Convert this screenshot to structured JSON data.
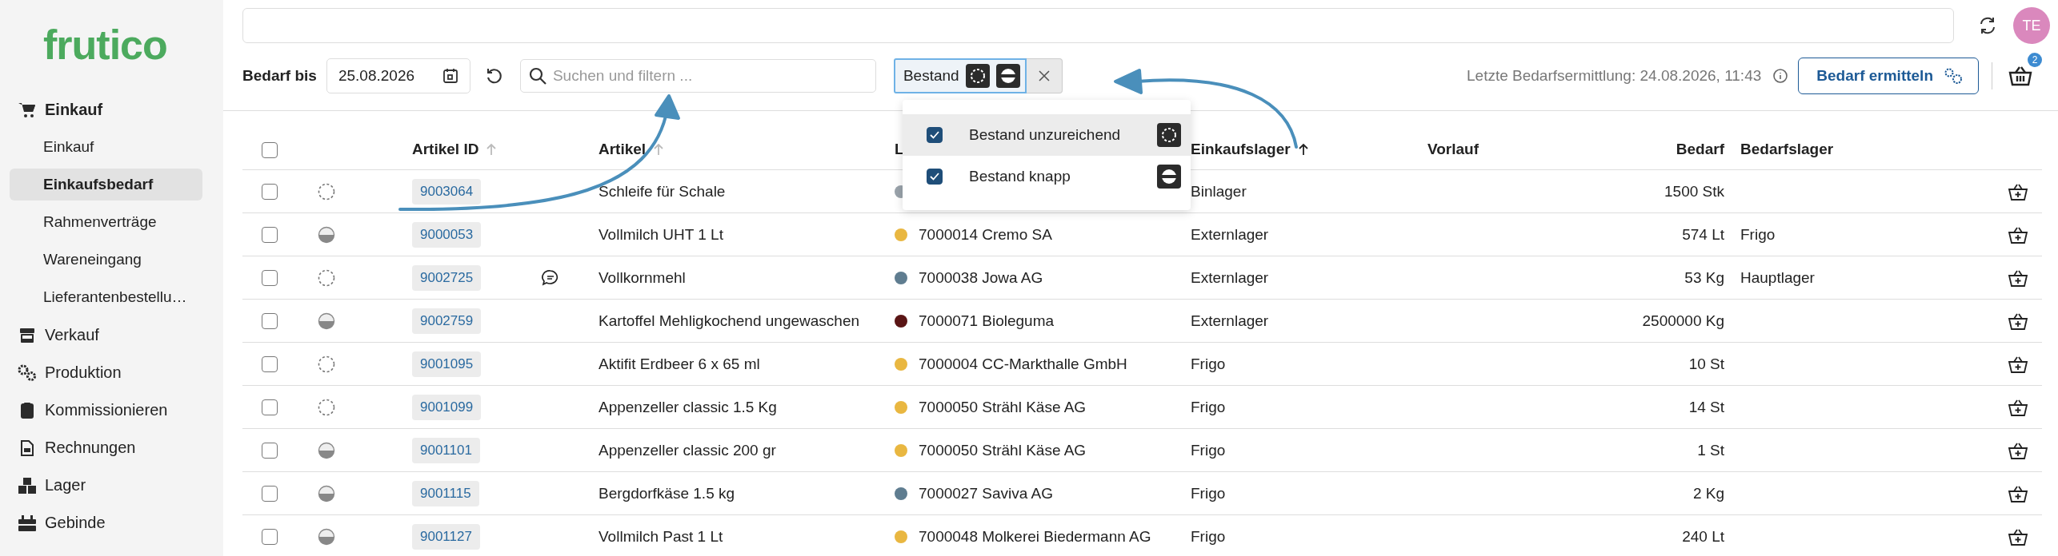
{
  "sidebar": {
    "logo": "frutico",
    "items": [
      {
        "label": "Einkauf",
        "expanded": true,
        "children": [
          {
            "label": "Einkauf",
            "selected": false
          },
          {
            "label": "Einkaufsbedarf",
            "selected": true
          },
          {
            "label": "Rahmenverträge",
            "selected": false
          },
          {
            "label": "Wareneingang",
            "selected": false
          },
          {
            "label": "Lieferantenbestellu…",
            "selected": false
          }
        ]
      },
      {
        "label": "Verkauf",
        "expanded": false
      },
      {
        "label": "Produktion",
        "expanded": false
      },
      {
        "label": "Kommissionieren",
        "expanded": false
      },
      {
        "label": "Rechnungen",
        "expanded": false
      },
      {
        "label": "Lager",
        "expanded": false
      },
      {
        "label": "Gebinde",
        "expanded": false
      }
    ]
  },
  "header": {
    "avatar": "TE"
  },
  "toolbar": {
    "date_label": "Bedarf bis",
    "date": "25.08.2026",
    "search": {
      "placeholder": "Suchen und filtern ..."
    },
    "filter_chip": {
      "label": "Bestand",
      "icons": [
        {
          "kind": "insufficient"
        },
        {
          "kind": "low"
        }
      ]
    },
    "last_run": "Letzte Bedarfsermittlung: 24.08.2026, 11:43",
    "action_button": "Bedarf ermitteln",
    "basket_badge": "2"
  },
  "filter_menu": {
    "items": [
      {
        "label": "Bestand unzureichend",
        "checked": true,
        "selected": true,
        "kind": "insufficient"
      },
      {
        "label": "Bestand knapp",
        "checked": true,
        "selected": false,
        "kind": "low"
      }
    ]
  },
  "table": {
    "select_all": {
      "checked": false
    },
    "columns": [
      {
        "label": "Artikel ID",
        "sorted": false
      },
      {
        "label": "Artikel",
        "sorted": false
      },
      {
        "label": "L"
      },
      {
        "label": "Einkaufslager",
        "sorted": true
      },
      {
        "label": "Vorlauf"
      },
      {
        "label": "Bedarf"
      },
      {
        "label": "Bedarfslager"
      }
    ],
    "rows": [
      {
        "checked": false,
        "kind": "insufficient",
        "id": "9003064",
        "comment": false,
        "article": "Schleife für Schale",
        "color": "#9aa3ab",
        "supplier": "",
        "warehouse": "Binlager",
        "demand": "1500 Stk",
        "demand_warehouse": ""
      },
      {
        "checked": false,
        "kind": "low",
        "id": "9000053",
        "comment": false,
        "article": "Vollmilch UHT 1 Lt",
        "color": "#e9b741",
        "supplier": "7000014 Cremo SA",
        "warehouse": "Externlager",
        "demand": "574 Lt",
        "demand_warehouse": "Frigo"
      },
      {
        "checked": false,
        "kind": "insufficient",
        "id": "9002725",
        "comment": true,
        "article": "Vollkornmehl",
        "color": "#5f7d90",
        "supplier": "7000038 Jowa AG",
        "warehouse": "Externlager",
        "demand": "53 Kg",
        "demand_warehouse": "Hauptlager"
      },
      {
        "checked": false,
        "kind": "low",
        "id": "9002759",
        "comment": false,
        "article": "Kartoffel Mehligkochend ungewaschen",
        "color": "#5a1515",
        "supplier": "7000071 Bioleguma",
        "warehouse": "Externlager",
        "demand": "2500000 Kg",
        "demand_warehouse": ""
      },
      {
        "checked": false,
        "kind": "insufficient",
        "id": "9001095",
        "comment": false,
        "article": "Aktifit Erdbeer 6 x 65 ml",
        "color": "#e9b741",
        "supplier": "7000004 CC-Markthalle GmbH",
        "warehouse": "Frigo",
        "demand": "10 St",
        "demand_warehouse": ""
      },
      {
        "checked": false,
        "kind": "insufficient",
        "id": "9001099",
        "comment": false,
        "article": "Appenzeller classic 1.5 Kg",
        "color": "#e9b741",
        "supplier": "7000050 Strähl Käse AG",
        "warehouse": "Frigo",
        "demand": "14 St",
        "demand_warehouse": ""
      },
      {
        "checked": false,
        "kind": "low",
        "id": "9001101",
        "comment": false,
        "article": "Appenzeller classic 200 gr",
        "color": "#e9b741",
        "supplier": "7000050 Strähl Käse AG",
        "warehouse": "Frigo",
        "demand": "1 St",
        "demand_warehouse": ""
      },
      {
        "checked": false,
        "kind": "low",
        "id": "9001115",
        "comment": false,
        "article": "Bergdorfkäse 1.5 kg",
        "color": "#5f7d90",
        "supplier": "7000027 Saviva AG",
        "warehouse": "Frigo",
        "demand": "2 Kg",
        "demand_warehouse": ""
      },
      {
        "checked": false,
        "kind": "low",
        "id": "9001127",
        "comment": false,
        "article": "Vollmilch Past 1 Lt",
        "color": "#e9b741",
        "supplier": "7000048 Molkerei Biedermann AG",
        "warehouse": "Frigo",
        "demand": "240 Lt",
        "demand_warehouse": ""
      }
    ]
  }
}
